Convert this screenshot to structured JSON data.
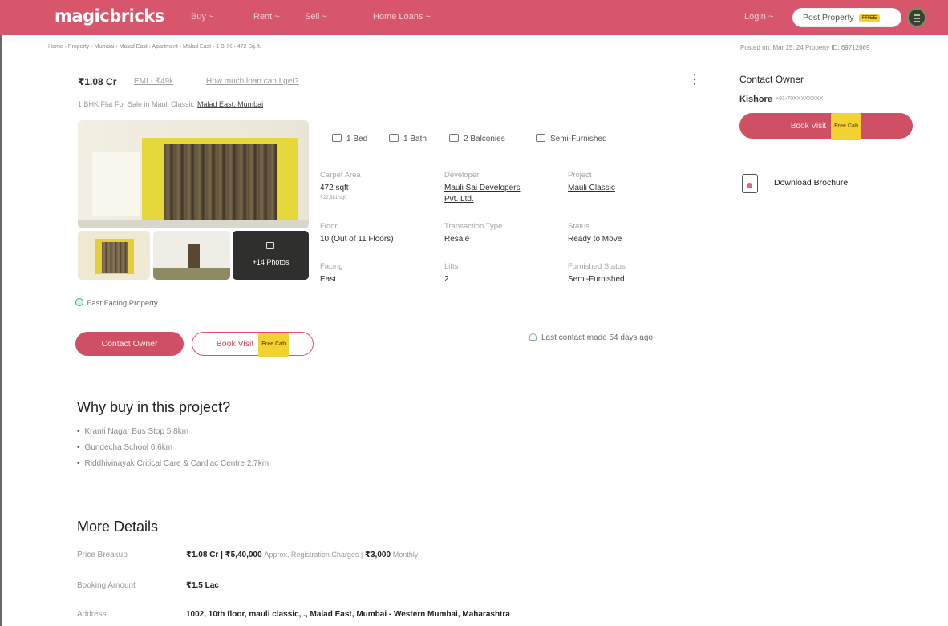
{
  "header": {
    "logo": "magicbricks",
    "nav": [
      "Buy ~",
      "Rent ~",
      "Sell ~",
      "Home Loans ~"
    ],
    "login": "Login ~",
    "post_property": "Post Property",
    "post_property_tag": "FREE"
  },
  "breadcrumb": "Home › Property › Mumbai › Malad East › Apartment › Malad East › 1 BHK › 472 Sq.ft.",
  "posted_info": "Posted on: Mar 15, 24    Property ID: 69712669",
  "listing": {
    "price": "₹1.08 Cr",
    "emi": "EMI - ₹49k",
    "loan_link": "How much loan can I get?",
    "subtitle": "1 BHK Flat For Sale in Mauli Classic",
    "location": "Malad East, Mumbai",
    "more_photos": "+14 Photos",
    "highlights": [
      {
        "icon": "bed-icon",
        "label": "1 Bed"
      },
      {
        "icon": "bath-icon",
        "label": "1 Bath"
      },
      {
        "icon": "balcony-icon",
        "label": "2 Balconies"
      },
      {
        "icon": "furnishing-icon",
        "label": "Semi-Furnished"
      }
    ],
    "details": {
      "carpet_label": "Carpet Area",
      "carpet_value": "472 sqft",
      "carpet_rate": "₹22,881/sqft",
      "developer_label": "Developer",
      "developer_value_1": "Mauli Sai Developers",
      "developer_value_2": "Pvt. Ltd.",
      "project_label": "Project",
      "project_value": "Mauli Classic",
      "floor_label": "Floor",
      "floor_value": "10 (Out of 11 Floors)",
      "transaction_label": "Transaction Type",
      "transaction_value": "Resale",
      "status_label": "Status",
      "status_value": "Ready to Move",
      "facing_label": "Facing",
      "facing_value": "East",
      "lifts_label": "Lifts",
      "lifts_value": "2",
      "furnished_label": "Furnished Status",
      "furnished_value": "Semi-Furnished"
    },
    "facing_tag": "East Facing Property",
    "contact_btn": "Contact Owner",
    "book_visit_btn": "Book Visit",
    "free_cab": "Free Cab",
    "last_contact": "Last contact made 54 days ago"
  },
  "sidebar": {
    "title": "Contact Owner",
    "owner_name": "Kishore",
    "owner_phone": "+91-70XXXXXXXX",
    "book_visit": "Book Visit",
    "free_cab": "Free Cab",
    "brochure": "Download Brochure"
  },
  "why_buy": {
    "title": "Why buy in this project?",
    "items": [
      "Kranti Nagar Bus Stop 5.8km",
      "Gundecha School 6.6km",
      "Riddhivinayak Critical Care & Cardiac Centre 2.7km"
    ]
  },
  "more_details": {
    "title": "More Details",
    "rows": [
      {
        "label": "Price Breakup",
        "value": "₹1.08 Cr | ₹5,40,000",
        "note": "Approx. Registration Charges |",
        "value2": "₹3,000",
        "note2": "Monthly"
      },
      {
        "label": "Booking Amount",
        "value": "₹1.5 Lac"
      },
      {
        "label": "Address",
        "value": "1002, 10th floor, mauli classic, ., Malad East, Mumbai - Western Mumbai, Maharashtra"
      }
    ]
  },
  "colors": {
    "brand": "#d8566c",
    "button": "#cf4f64",
    "free_tag": "#f2d233"
  }
}
